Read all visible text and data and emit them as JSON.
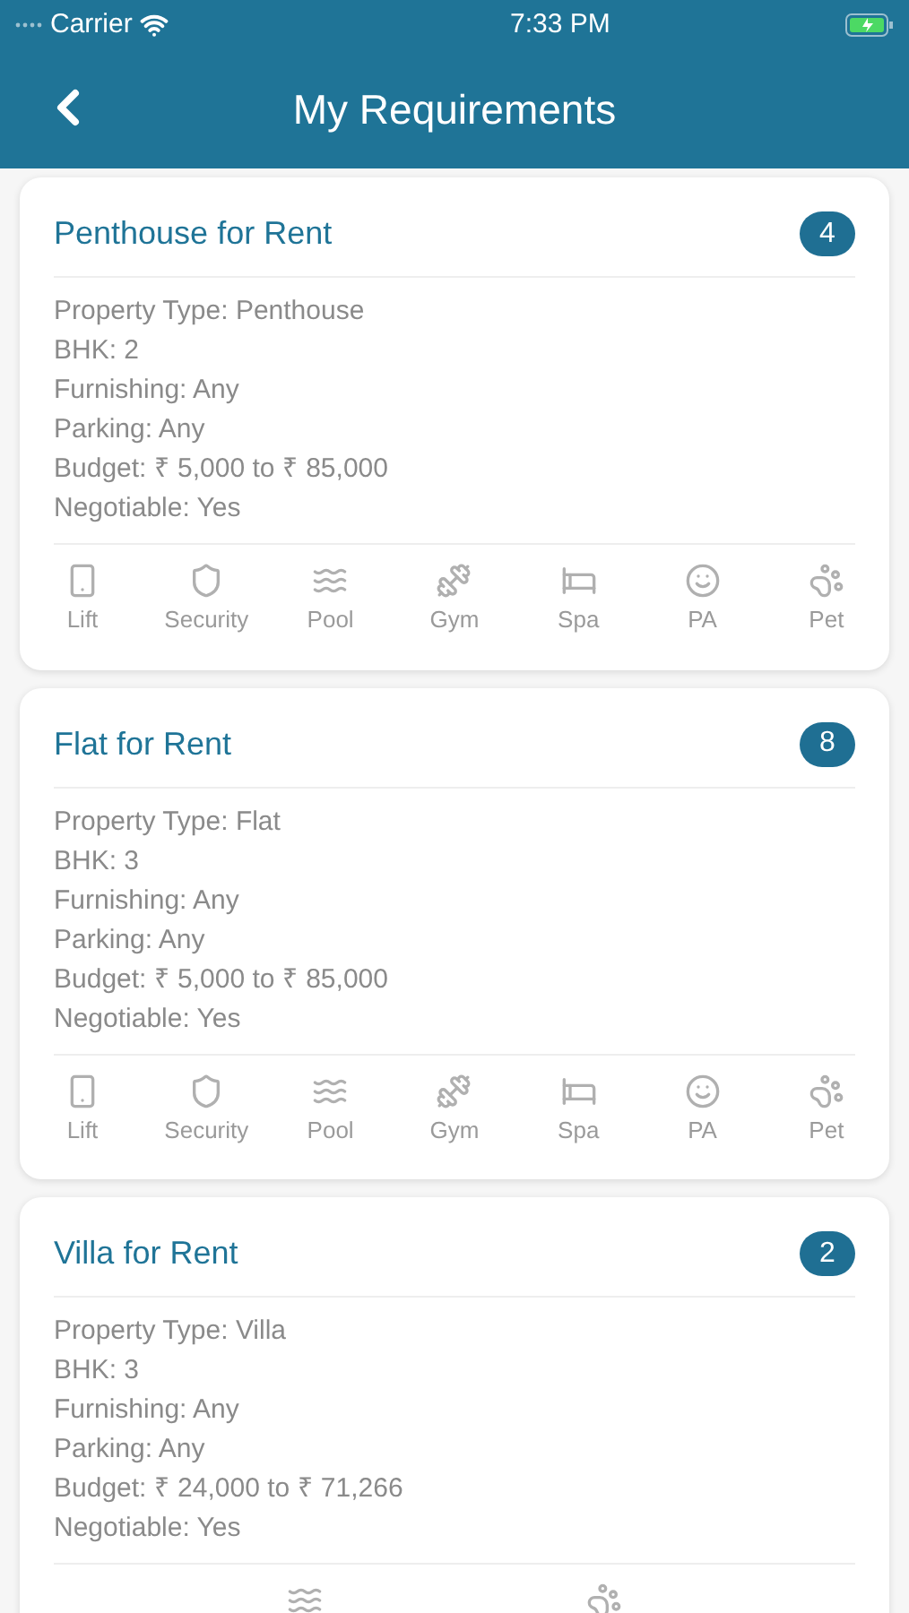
{
  "status_bar": {
    "carrier": "Carrier",
    "time": "7:33 PM"
  },
  "nav": {
    "title": "My Requirements"
  },
  "cards": [
    {
      "title": "Penthouse for Rent",
      "count": "4",
      "details": [
        "Property Type: Penthouse",
        "BHK: 2",
        "Furnishing: Any",
        "Parking: Any",
        "Budget: ₹ 5,000 to ₹ 85,000",
        "Negotiable: Yes"
      ],
      "amenities": [
        {
          "kind": "lift",
          "label": "Lift"
        },
        {
          "kind": "security",
          "label": "Security"
        },
        {
          "kind": "pool",
          "label": "Pool"
        },
        {
          "kind": "gym",
          "label": "Gym"
        },
        {
          "kind": "spa",
          "label": "Spa"
        },
        {
          "kind": "pa",
          "label": "PA"
        },
        {
          "kind": "pet",
          "label": "Pet"
        }
      ]
    },
    {
      "title": "Flat for Rent",
      "count": "8",
      "details": [
        "Property Type: Flat",
        "BHK: 3",
        "Furnishing: Any",
        "Parking: Any",
        "Budget: ₹ 5,000 to ₹ 85,000",
        "Negotiable: Yes"
      ],
      "amenities": [
        {
          "kind": "lift",
          "label": "Lift"
        },
        {
          "kind": "security",
          "label": "Security"
        },
        {
          "kind": "pool",
          "label": "Pool"
        },
        {
          "kind": "gym",
          "label": "Gym"
        },
        {
          "kind": "spa",
          "label": "Spa"
        },
        {
          "kind": "pa",
          "label": "PA"
        },
        {
          "kind": "pet",
          "label": "Pet"
        }
      ]
    },
    {
      "title": "Villa for Rent",
      "count": "2",
      "details": [
        "Property Type: Villa",
        "BHK: 3",
        "Furnishing: Any",
        "Parking: Any",
        "Budget: ₹ 24,000 to ₹ 71,266",
        "Negotiable: Yes"
      ],
      "amenities": [
        {
          "kind": "pool"
        },
        {
          "kind": "pet"
        }
      ]
    }
  ]
}
